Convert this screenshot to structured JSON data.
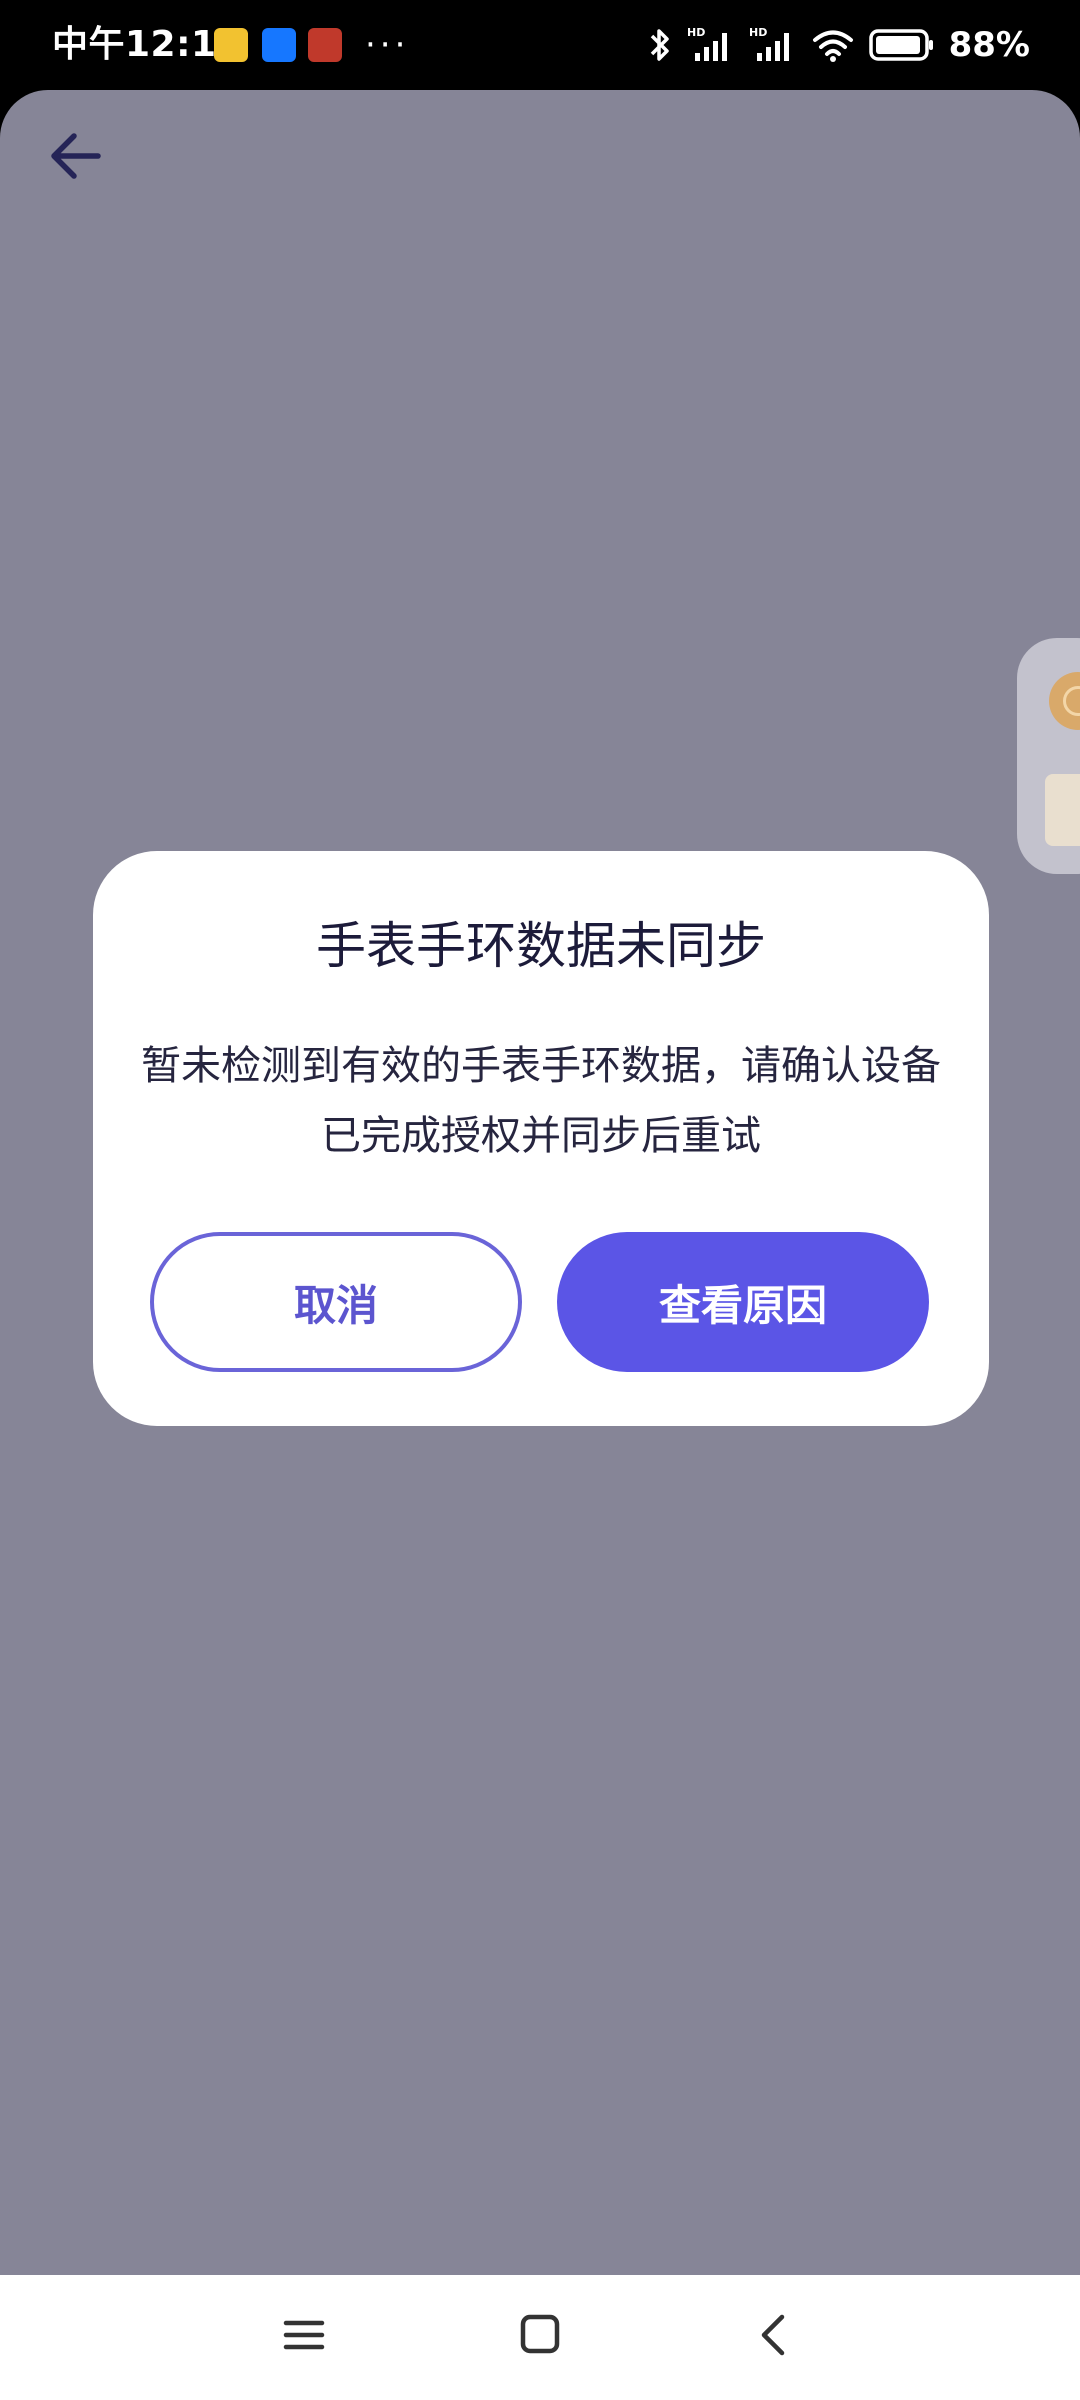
{
  "status_bar": {
    "time": "中午12:13",
    "more_dots": "···",
    "battery": "88%",
    "icons": [
      "app-notification-icon-1",
      "alipay-icon",
      "app-notification-icon-3",
      "bluetooth-icon",
      "signal-hd-icon-1",
      "signal-hd-icon-2",
      "wifi-icon",
      "battery-icon"
    ],
    "notification_colors": [
      "#f2c230",
      "#1677ff",
      "#c0392b"
    ]
  },
  "app": {
    "back_icon": "arrow-left-icon",
    "background_color": "#868597"
  },
  "dialog": {
    "title": "手表手环数据未同步",
    "message": "暂未检测到有效的手表手环数据，请确认设备已完成授权并同步后重试",
    "cancel_label": "取消",
    "confirm_label": "查看原因",
    "accent_color": "#5b55e6"
  },
  "nav_bar": {
    "icons": [
      "menu-icon",
      "home-icon",
      "back-icon"
    ]
  }
}
